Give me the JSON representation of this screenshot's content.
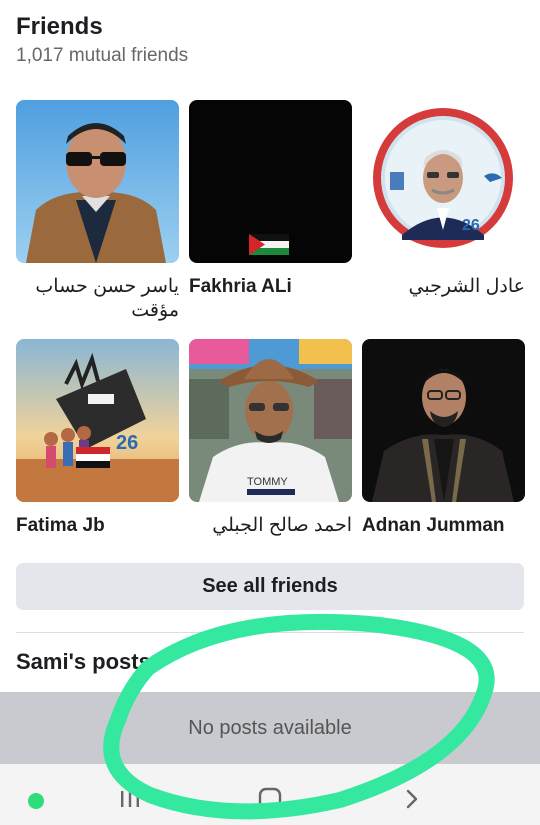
{
  "friends": {
    "title": "Friends",
    "mutual": "1,017 mutual friends",
    "items": [
      {
        "name": "ياسر حسن حساب مؤقت",
        "rtl": true
      },
      {
        "name": "Fakhria ALi",
        "rtl": false
      },
      {
        "name": "عادل الشرجبي",
        "rtl": true
      },
      {
        "name": "Fatima Jb",
        "rtl": false
      },
      {
        "name": "احمد صالح الجبلي",
        "rtl": true
      },
      {
        "name": "Adnan Jumman",
        "rtl": false
      }
    ],
    "see_all_label": "See all friends"
  },
  "posts": {
    "title": "Sami's posts",
    "empty_text": "No posts available"
  },
  "navbar": {
    "icons": [
      "recent-apps-icon",
      "home-icon",
      "back-icon"
    ]
  },
  "colors": {
    "annotation": "#34e8a0",
    "status_dot": "#2edc7a"
  }
}
